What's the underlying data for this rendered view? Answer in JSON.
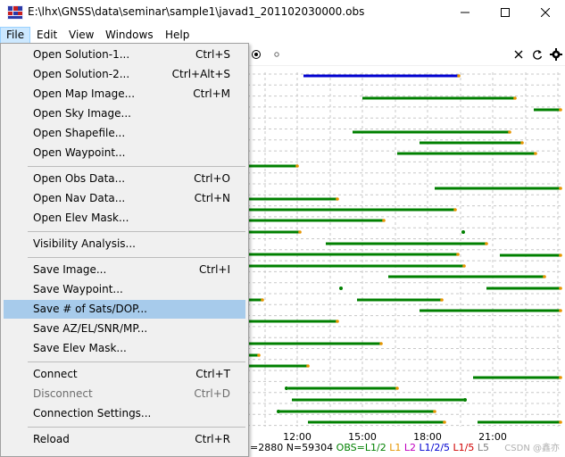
{
  "window": {
    "title": "E:\\lhx\\GNSS\\data\\seminar\\sample1\\javad1_201102030000.obs",
    "minimize_icon": "minimize-icon",
    "maximize_icon": "maximize-icon",
    "close_icon": "close-icon"
  },
  "menubar": {
    "items": [
      {
        "label": "File"
      },
      {
        "label": "Edit"
      },
      {
        "label": "View"
      },
      {
        "label": "Windows"
      },
      {
        "label": "Help"
      }
    ]
  },
  "file_menu": {
    "items": [
      {
        "label": "Open Solution-1...",
        "shortcut": "Ctrl+S"
      },
      {
        "label": "Open Solution-2...",
        "shortcut": "Ctrl+Alt+S"
      },
      {
        "label": "Open Map Image...",
        "shortcut": "Ctrl+M"
      },
      {
        "label": "Open Sky Image...",
        "shortcut": ""
      },
      {
        "label": "Open Shapefile...",
        "shortcut": ""
      },
      {
        "label": "Open Waypoint...",
        "shortcut": ""
      },
      {
        "label": "Open Obs Data...",
        "shortcut": "Ctrl+O"
      },
      {
        "label": "Open Nav Data...",
        "shortcut": "Ctrl+N"
      },
      {
        "label": "Open Elev Mask...",
        "shortcut": ""
      },
      {
        "label": "Visibility Analysis...",
        "shortcut": ""
      },
      {
        "label": "Save Image...",
        "shortcut": "Ctrl+I"
      },
      {
        "label": "Save Waypoint...",
        "shortcut": ""
      },
      {
        "label": "Save # of Sats/DOP...",
        "shortcut": ""
      },
      {
        "label": "Save AZ/EL/SNR/MP...",
        "shortcut": ""
      },
      {
        "label": "Save Elev Mask...",
        "shortcut": ""
      },
      {
        "label": "Connect",
        "shortcut": "Ctrl+T"
      },
      {
        "label": "Disconnect",
        "shortcut": "Ctrl+D"
      },
      {
        "label": "Connection Settings...",
        "shortcut": ""
      },
      {
        "label": "Reload",
        "shortcut": "Ctrl+R"
      }
    ]
  },
  "toolbar": {
    "icons": [
      "target-icon",
      "dot-icon",
      "close-icon",
      "refresh-icon",
      "settings-gear-icon"
    ]
  },
  "chart_data": {
    "type": "timeline",
    "x_tick_labels": [
      "12:00",
      "15:00",
      "18:00",
      "21:00"
    ],
    "colors": {
      "l1l2": "#008000",
      "l1l2l5": "#0000d0",
      "l1": "#e69500"
    }
  },
  "status": {
    "text_prefix": "=2880 N=59304",
    "obs_label": "OBS=L1/2",
    "l1": "L1",
    "l2": "L2",
    "l125": "L1/2/5",
    "l15": "L1/5",
    "l5": "L5"
  },
  "watermark": "CSDN @鑫亦"
}
